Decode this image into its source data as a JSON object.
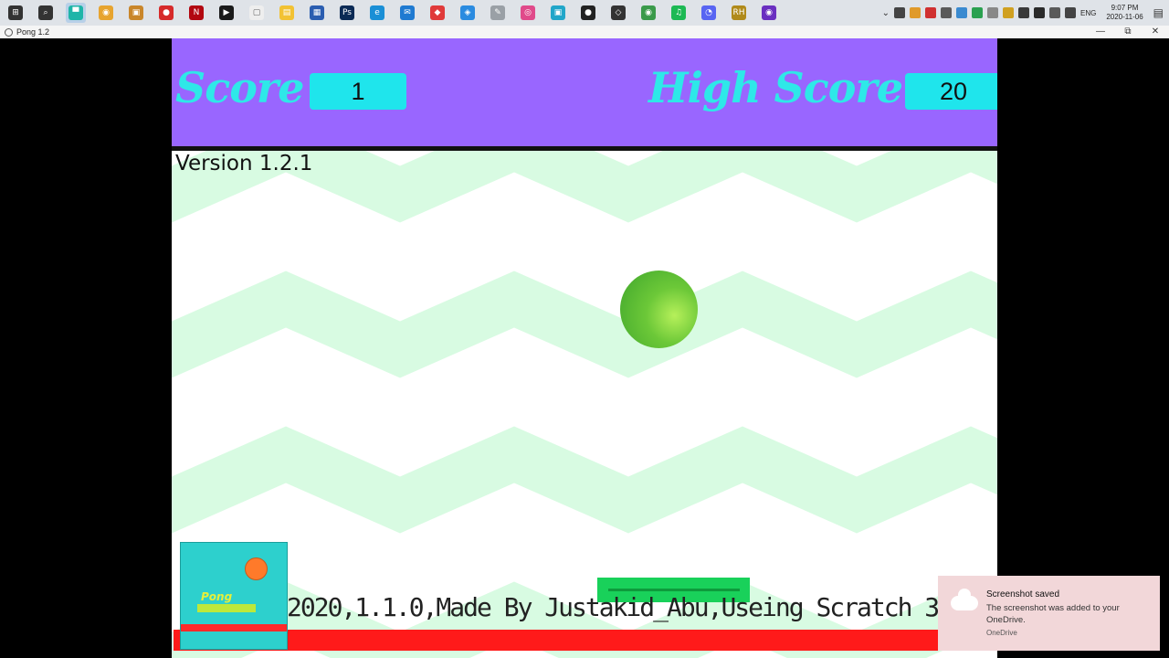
{
  "taskbar": {
    "icons": [
      {
        "name": "start-icon",
        "color": "#333333",
        "glyph": "⊞"
      },
      {
        "name": "search-icon",
        "color": "#333333",
        "glyph": "⌕"
      },
      {
        "name": "pong-app-icon",
        "color": "#1fb5a8",
        "glyph": "▀"
      },
      {
        "name": "chrome-icon",
        "color": "#e7a42f",
        "glyph": "◉"
      },
      {
        "name": "app-icon",
        "color": "#c9862a",
        "glyph": "▣"
      },
      {
        "name": "among-us-icon",
        "color": "#d62a2a",
        "glyph": "●"
      },
      {
        "name": "netflix-icon",
        "color": "#b20710",
        "glyph": "N"
      },
      {
        "name": "terminal-icon",
        "color": "#1a1a1a",
        "glyph": "▶"
      },
      {
        "name": "file-icon",
        "color": "#eeeeee",
        "glyph": "▢"
      },
      {
        "name": "file-explorer-icon",
        "color": "#f2c233",
        "glyph": "▤"
      },
      {
        "name": "store-icon",
        "color": "#2a5db0",
        "glyph": "▦"
      },
      {
        "name": "photoshop-icon",
        "color": "#0a2a55",
        "glyph": "Ps"
      },
      {
        "name": "edge-icon",
        "color": "#1a8fd6",
        "glyph": "e"
      },
      {
        "name": "mail-icon",
        "color": "#1f7ad1",
        "glyph": "✉"
      },
      {
        "name": "roblox-icon",
        "color": "#e03a3a",
        "glyph": "◆"
      },
      {
        "name": "roblox-studio-icon",
        "color": "#2a8be0",
        "glyph": "◈"
      },
      {
        "name": "paint-icon",
        "color": "#9aa0a6",
        "glyph": "✎"
      },
      {
        "name": "instagram-icon",
        "color": "#e04a8a",
        "glyph": "◎"
      },
      {
        "name": "app-icon-2",
        "color": "#21a6c9",
        "glyph": "▣"
      },
      {
        "name": "obs-icon",
        "color": "#222222",
        "glyph": "●"
      },
      {
        "name": "unity-icon",
        "color": "#333333",
        "glyph": "◇"
      },
      {
        "name": "chrome-icon-2",
        "color": "#3a9a4a",
        "glyph": "◉"
      },
      {
        "name": "spotify-icon",
        "color": "#1db954",
        "glyph": "♫"
      },
      {
        "name": "discord-icon",
        "color": "#5865f2",
        "glyph": "◔"
      },
      {
        "name": "rh-icon",
        "color": "#b08a1a",
        "glyph": "RH"
      },
      {
        "name": "app-icon-3",
        "color": "#6a2fc0",
        "glyph": "◉"
      }
    ],
    "active_index": 2,
    "tray": {
      "lang": "ENG",
      "time": "9:07 PM",
      "date": "2020-11-06",
      "icon_colors": [
        "#444444",
        "#e09a2a",
        "#d03030",
        "#5a5a5a",
        "#3a8ad0",
        "#2aa050",
        "#888888",
        "#d0a020",
        "#3a3a3a",
        "#2a2a2a",
        "#5a5a5a",
        "#444444"
      ]
    }
  },
  "window": {
    "title": "Pong 1.2",
    "min": "—",
    "restore": "⧉",
    "close": "✕"
  },
  "game": {
    "score_label": "Score",
    "score_value": "1",
    "high_score_label": "High Score",
    "high_score_value": "20",
    "version": "Version 1.2.1",
    "credits": "2020,1.1.0,Made By Justakid_Abu,Useing Scratch 3.0",
    "logo_text": "Pong",
    "background_color": "#d8fbe2",
    "header_color": "#9966ff"
  },
  "toast": {
    "title": "Screenshot saved",
    "body": "The screenshot was added to your OneDrive.",
    "source": "OneDrive"
  }
}
